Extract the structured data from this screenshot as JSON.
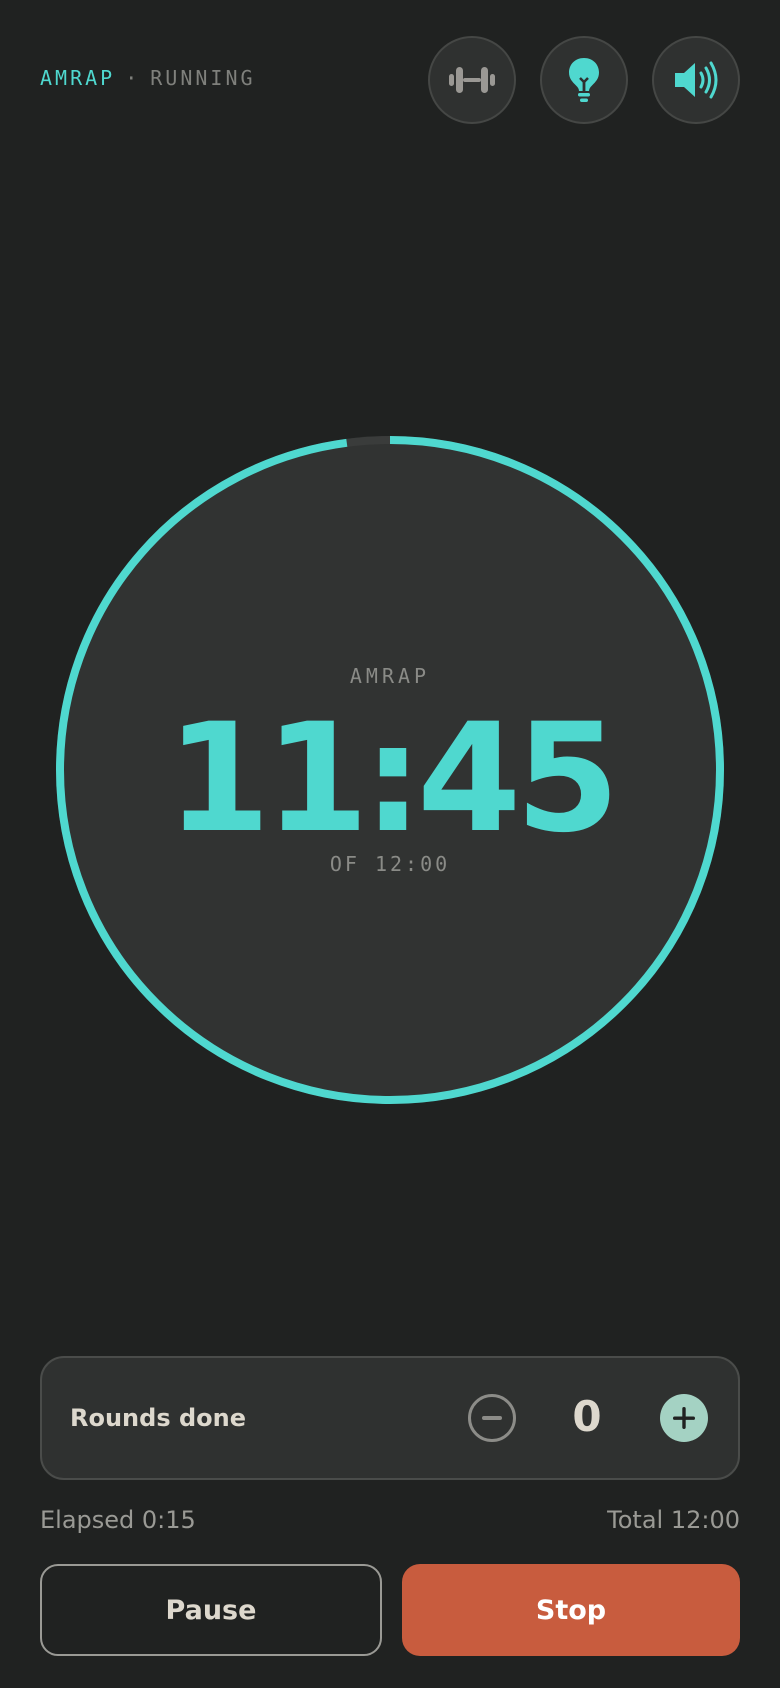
{
  "header": {
    "mode": "AMRAP",
    "separator": "·",
    "state": "RUNNING"
  },
  "icons": {
    "workout": "dumbbell-icon",
    "hint": "lightbulb-icon",
    "sound": "speaker-volume-icon"
  },
  "timer": {
    "label": "AMRAP",
    "remaining": "11:45",
    "total_label": "OF 12:00",
    "progress_remaining": 0.979
  },
  "rounds": {
    "label": "Rounds done",
    "value": "0"
  },
  "stats": {
    "elapsed": "Elapsed 0:15",
    "total": "Total 12:00"
  },
  "actions": {
    "pause_label": "Pause",
    "stop_label": "Stop"
  },
  "colors": {
    "background": "#202221",
    "accent": "#4fd8cf",
    "surface": "#313332",
    "stop": "#c85c3e",
    "plus": "#a4d2c3"
  }
}
